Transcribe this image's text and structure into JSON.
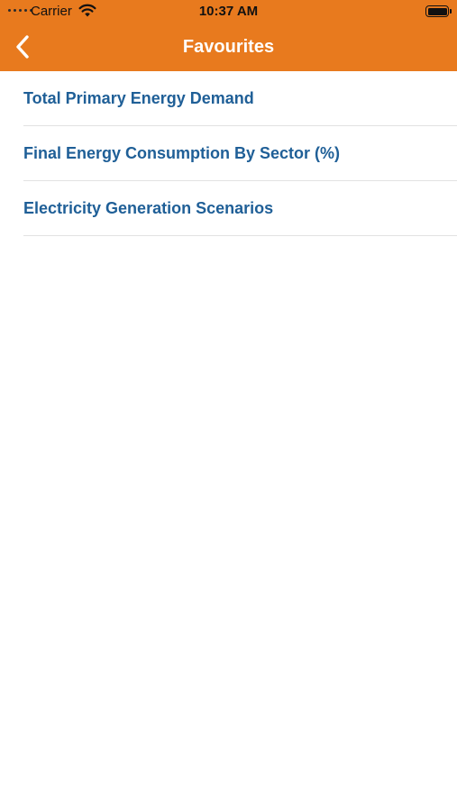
{
  "status_bar": {
    "carrier": "Carrier",
    "time": "10:37 AM",
    "signal_icon": "signal-dots-icon",
    "wifi_icon": "wifi-icon",
    "battery_icon": "battery-icon",
    "battery_level": 1.0
  },
  "nav": {
    "title": "Favourites",
    "back_icon": "chevron-left-icon"
  },
  "favourites": [
    {
      "label": "Total Primary Energy Demand"
    },
    {
      "label": "Final Energy Consumption By Sector (%)"
    },
    {
      "label": "Electricity Generation Scenarios"
    }
  ],
  "colors": {
    "accent": "#E87A1E",
    "link": "#1F5F97",
    "nav_text": "#FFFFFF",
    "separator": "#E2E2E2"
  }
}
